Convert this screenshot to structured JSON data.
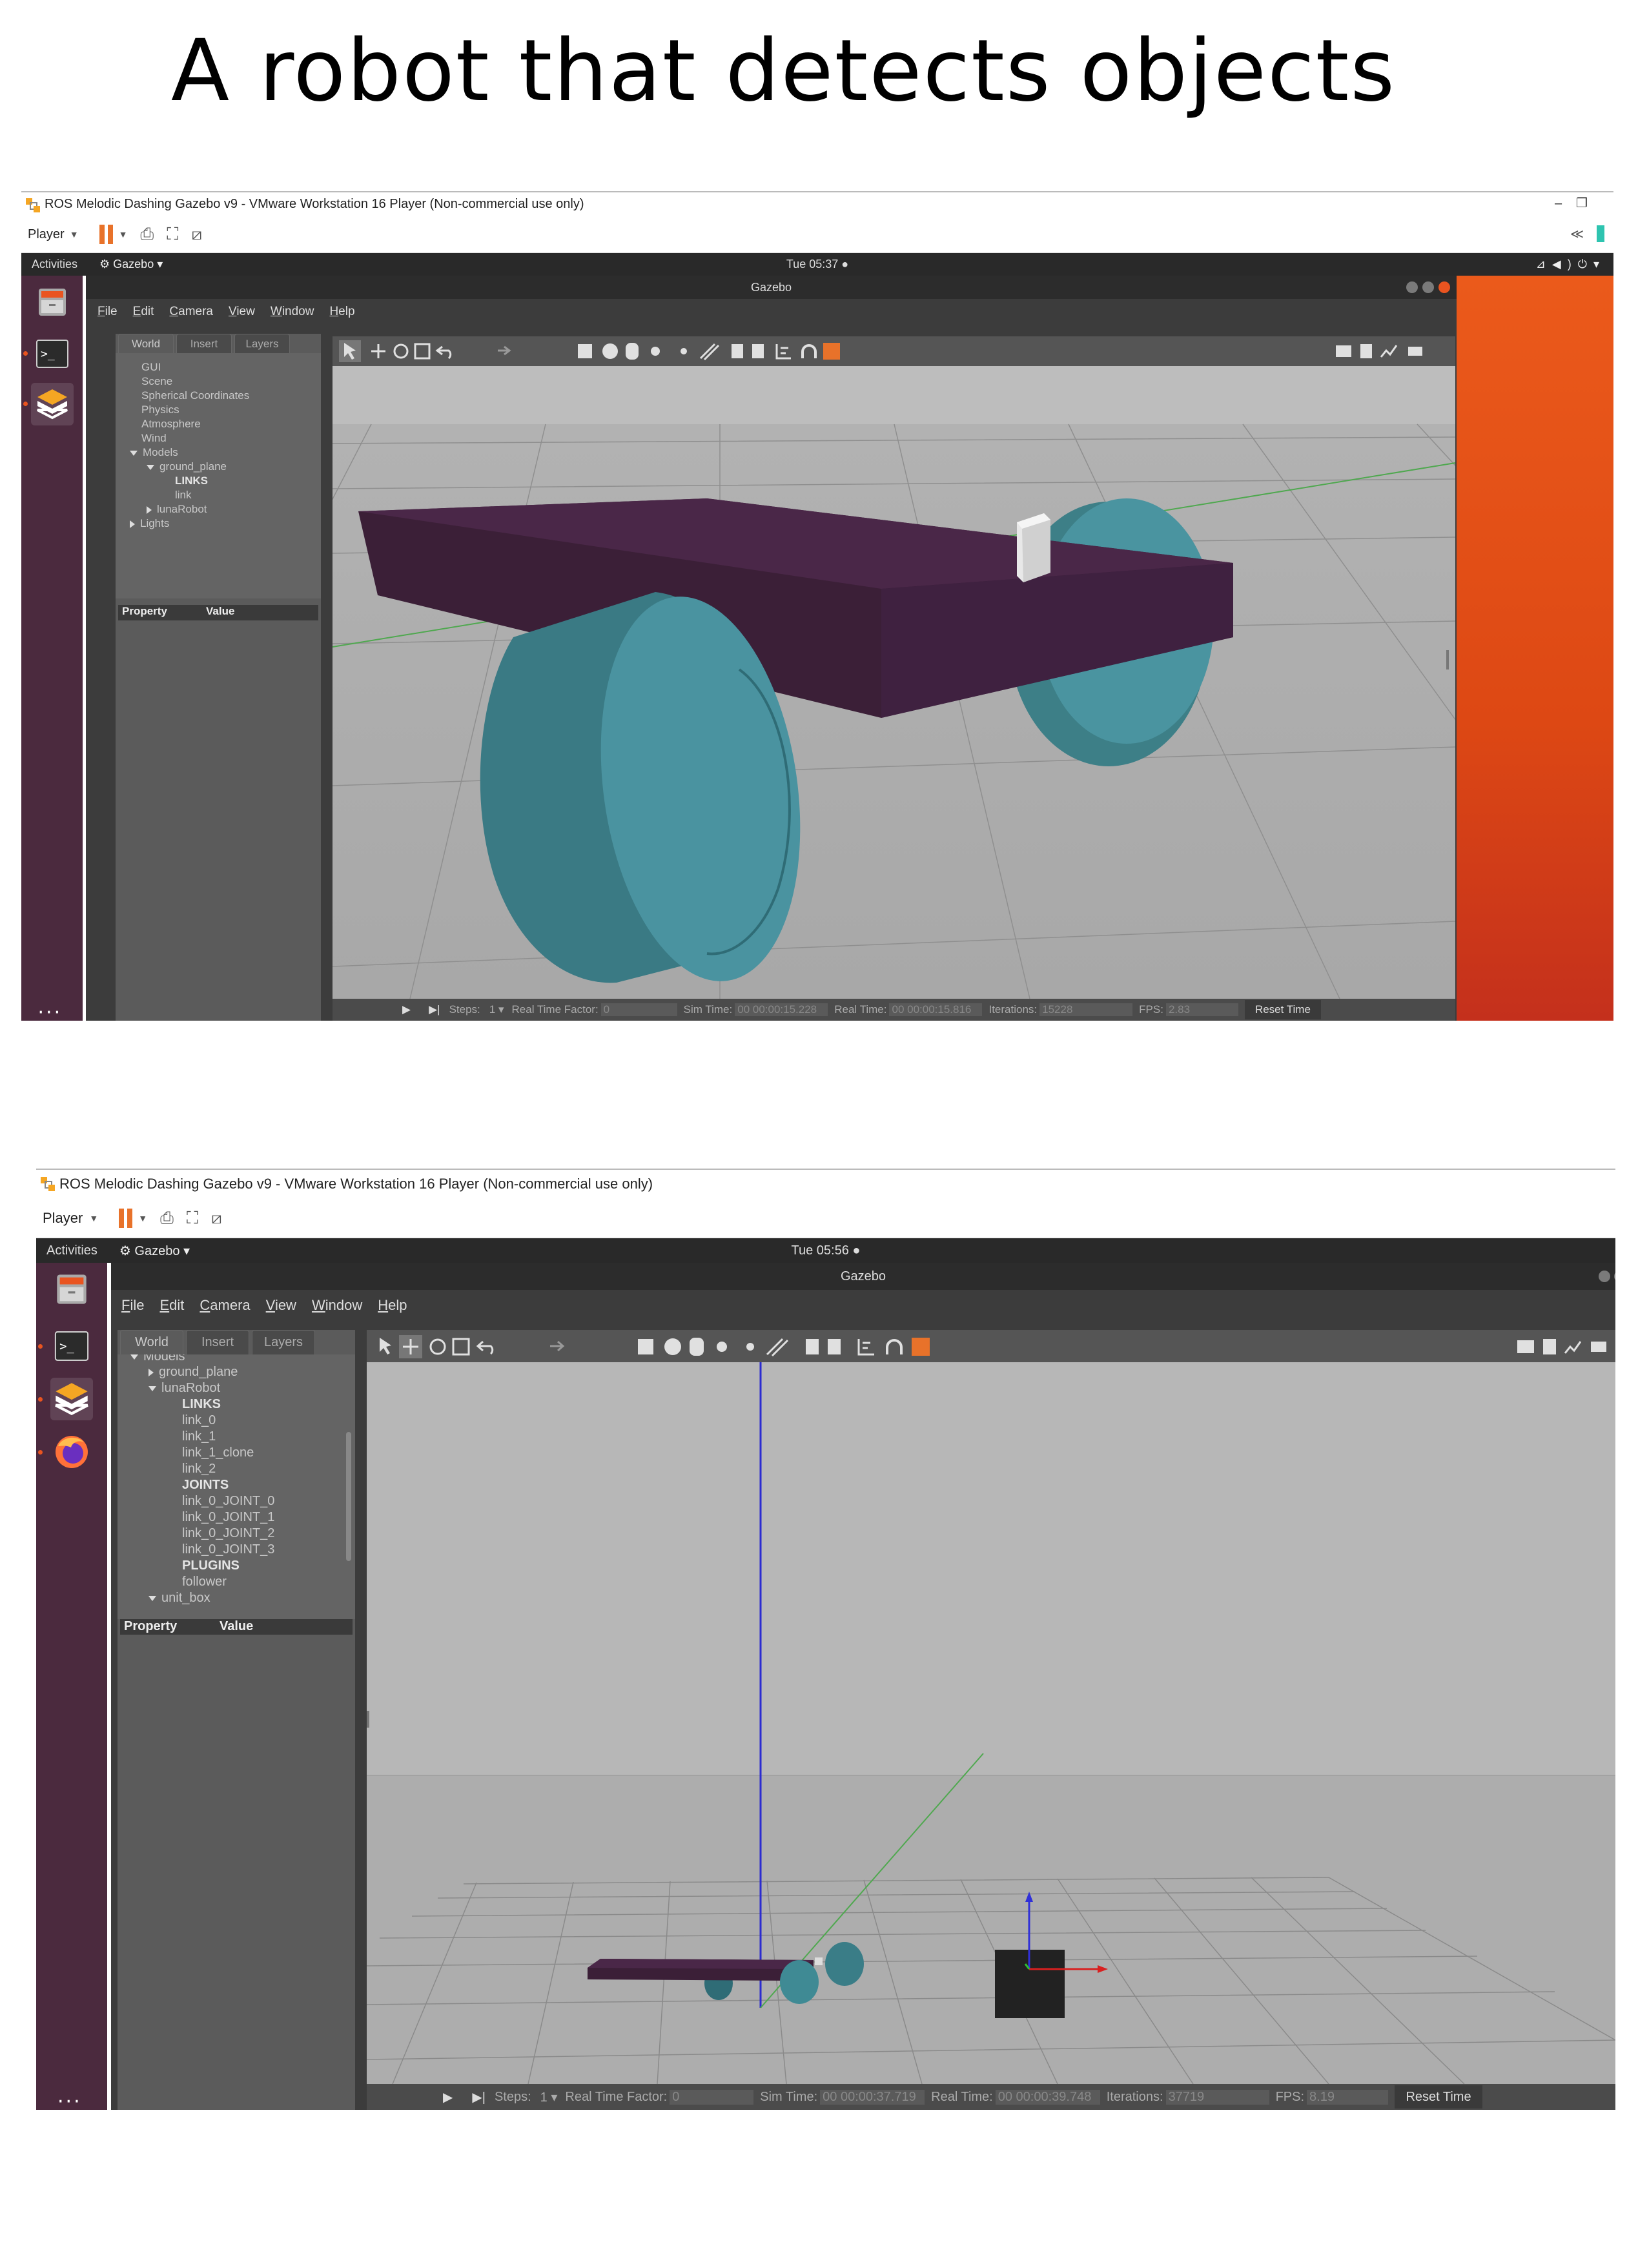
{
  "meme_title": "A robot that detects objects",
  "colors": {
    "ubuntu_orange": "#e95420",
    "robot_body": "#4a2748",
    "wheel": "#3f8a94",
    "scene_bg": "#b8b8b8",
    "dock": "#4b2a3e"
  },
  "screenshots": [
    {
      "vm_title": "ROS Melodic Dashing Gazebo v9 - VMware Workstation 16 Player (Non-commercial use only)",
      "player_label": "Player",
      "activities": "Activities",
      "app_menu": "Gazebo",
      "clock": "Tue 05:37",
      "window_title": "Gazebo",
      "menu": [
        "File",
        "Edit",
        "Camera",
        "View",
        "Window",
        "Help"
      ],
      "tabs": [
        "World",
        "Insert",
        "Layers"
      ],
      "tree": [
        "GUI",
        "Scene",
        "Spherical Coordinates",
        "Physics",
        "Atmosphere",
        "Wind",
        "Models",
        "ground_plane",
        "LINKS",
        "link",
        "lunaRobot",
        "Lights"
      ],
      "property_header": [
        "Property",
        "Value"
      ],
      "status": {
        "steps_label": "Steps:",
        "steps_value": "1",
        "rtf_label": "Real Time Factor:",
        "rtf_value": "0",
        "sim_label": "Sim Time:",
        "sim_value": "00 00:00:15.228",
        "real_label": "Real Time:",
        "real_value": "00 00:00:15.816",
        "iter_label": "Iterations:",
        "iter_value": "15228",
        "fps_label": "FPS:",
        "fps_value": "2.83",
        "reset": "Reset Time"
      }
    },
    {
      "vm_title": "ROS Melodic Dashing Gazebo v9 - VMware Workstation 16 Player (Non-commercial use only)",
      "player_label": "Player",
      "activities": "Activities",
      "app_menu": "Gazebo",
      "clock": "Tue 05:56",
      "window_title": "Gazebo",
      "menu": [
        "File",
        "Edit",
        "Camera",
        "View",
        "Window",
        "Help"
      ],
      "tabs": [
        "World",
        "Insert",
        "Layers"
      ],
      "tree": [
        "Models",
        "ground_plane",
        "lunaRobot",
        "LINKS",
        "link_0",
        "link_1",
        "link_1_clone",
        "link_2",
        "JOINTS",
        "link_0_JOINT_0",
        "link_0_JOINT_1",
        "link_0_JOINT_2",
        "link_0_JOINT_3",
        "PLUGINS",
        "follower",
        "unit_box"
      ],
      "property_header": [
        "Property",
        "Value"
      ],
      "status": {
        "steps_label": "Steps:",
        "steps_value": "1",
        "rtf_label": "Real Time Factor:",
        "rtf_value": "0",
        "sim_label": "Sim Time:",
        "sim_value": "00 00:00:37.719",
        "real_label": "Real Time:",
        "real_value": "00 00:00:39.748",
        "iter_label": "Iterations:",
        "iter_value": "37719",
        "fps_label": "FPS:",
        "fps_value": "8.19",
        "reset": "Reset Time"
      }
    }
  ]
}
